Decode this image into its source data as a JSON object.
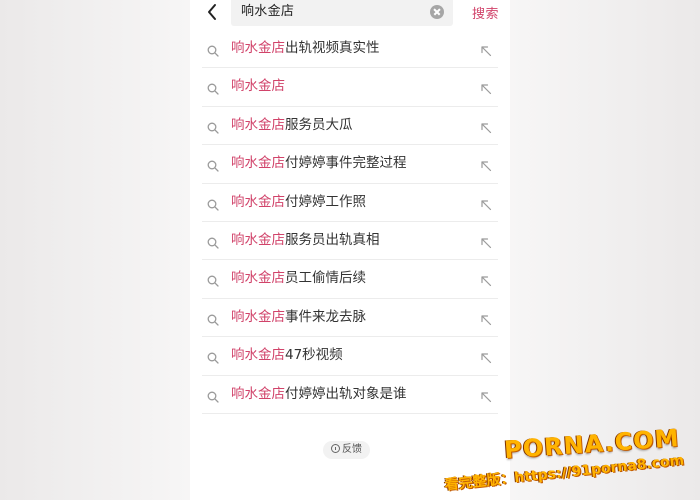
{
  "header": {
    "search_value": "响水金店",
    "search_button_label": "搜索"
  },
  "keyword": "响水金店",
  "suggestions": [
    {
      "keyword": "响水金店",
      "suffix": "出轨视频真实性"
    },
    {
      "keyword": "响水金店",
      "suffix": ""
    },
    {
      "keyword": "响水金店",
      "suffix": "服务员大瓜"
    },
    {
      "keyword": "响水金店",
      "suffix": "付婷婷事件完整过程"
    },
    {
      "keyword": "响水金店",
      "suffix": "付婷婷工作照"
    },
    {
      "keyword": "响水金店",
      "suffix": "服务员出轨真相"
    },
    {
      "keyword": "响水金店",
      "suffix": "员工偷情后续"
    },
    {
      "keyword": "响水金店",
      "suffix": "事件来龙去脉"
    },
    {
      "keyword": "响水金店",
      "suffix": "47秒视频"
    },
    {
      "keyword": "响水金店",
      "suffix": "付婷婷出轨对象是谁"
    }
  ],
  "feedback_label": "反馈",
  "watermark": {
    "logo": "PORNA.COM",
    "url_text": "看完整版：https://91porna8.com"
  },
  "colors": {
    "accent": "#d1436a",
    "watermark": "#ffb300"
  },
  "icons": {
    "back": "back-arrow-icon",
    "clear": "clear-icon",
    "search": "search-icon",
    "fill": "arrow-up-left-icon",
    "info": "info-icon"
  }
}
